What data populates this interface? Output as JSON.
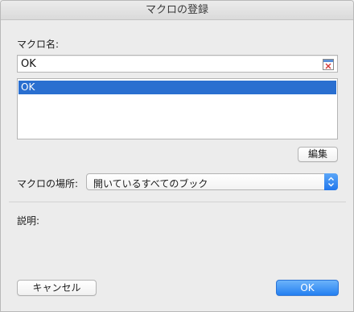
{
  "window": {
    "title": "マクロの登録"
  },
  "macro_name": {
    "label": "マクロ名:",
    "value": "OK"
  },
  "macro_list": {
    "items": [
      "OK"
    ],
    "selected_index": 0
  },
  "edit_button": {
    "label": "編集"
  },
  "location": {
    "label": "マクロの場所:",
    "selected": "開いているすべてのブック"
  },
  "description": {
    "label": "説明:"
  },
  "footer": {
    "cancel_label": "キャンセル",
    "ok_label": "OK"
  },
  "colors": {
    "accent": "#2a6fd0",
    "ok_button": "#2480f1",
    "window_bg": "#ececec"
  },
  "icons": {
    "ref_edit": "range-select-icon",
    "select_arrow": "up-down-chevron-icon"
  }
}
